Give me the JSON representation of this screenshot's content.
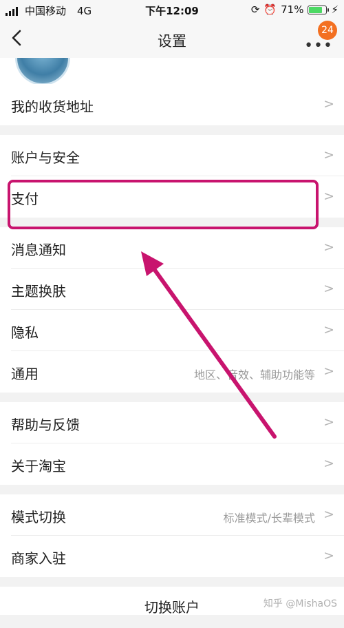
{
  "status_bar": {
    "carrier": "中国移动",
    "network": "4G",
    "time": "下午12:09",
    "battery": "71%"
  },
  "nav": {
    "title": "设置",
    "badge": "24"
  },
  "items": [
    {
      "label": "我的收货地址"
    },
    {
      "label": "账户与安全"
    },
    {
      "label": "支付"
    },
    {
      "label": "消息通知"
    },
    {
      "label": "主题换肤"
    },
    {
      "label": "隐私"
    },
    {
      "label": "通用",
      "sub": "地区、音效、辅助功能等"
    },
    {
      "label": "帮助与反馈"
    },
    {
      "label": "关于淘宝"
    },
    {
      "label": "模式切换",
      "sub": "标准模式/长辈模式"
    },
    {
      "label": "商家入驻"
    }
  ],
  "footer": {
    "switch_account": "切换账户"
  },
  "watermark": "知乎 @MishaOS",
  "colors": {
    "highlight": "#c8146e",
    "badge": "#f37021",
    "battery": "#4cd964"
  }
}
